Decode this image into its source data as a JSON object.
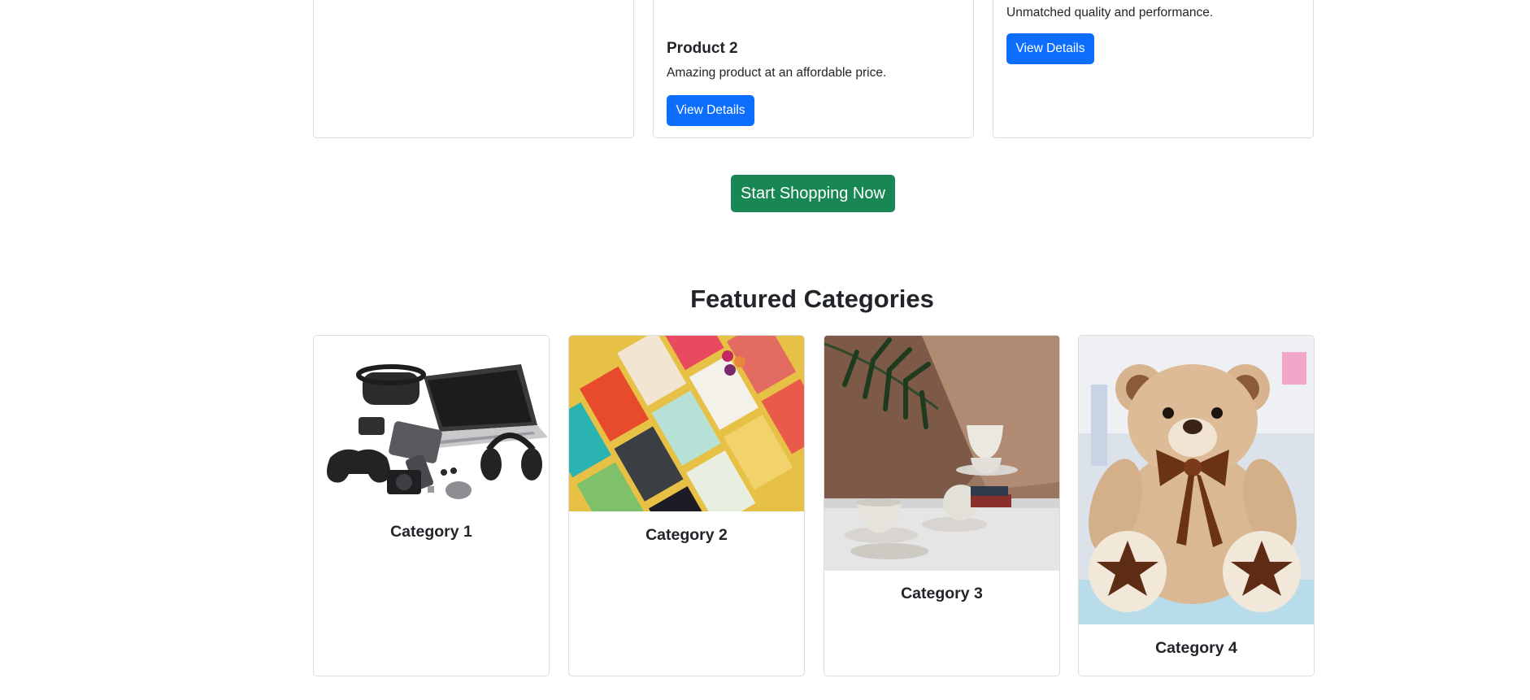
{
  "products": [
    {
      "title": "",
      "description": "",
      "button": ""
    },
    {
      "title": "Product 2",
      "description": "Amazing product at an affordable price.",
      "button": "View Details"
    },
    {
      "title": "",
      "description": "Unmatched quality and performance.",
      "button": "View Details"
    }
  ],
  "cta": {
    "label": "Start Shopping Now",
    "color": "#198754"
  },
  "featured": {
    "title": "Featured Categories",
    "categories": [
      {
        "title": "Category 1",
        "image": "electronics-gadgets-image"
      },
      {
        "title": "Category 2",
        "image": "books-image"
      },
      {
        "title": "Category 3",
        "image": "home-tableware-image"
      },
      {
        "title": "Category 4",
        "image": "teddy-bear-toy-image"
      }
    ]
  },
  "colors": {
    "primary": "#0d6efd",
    "success": "#198754",
    "border": "#dcdcdc"
  }
}
